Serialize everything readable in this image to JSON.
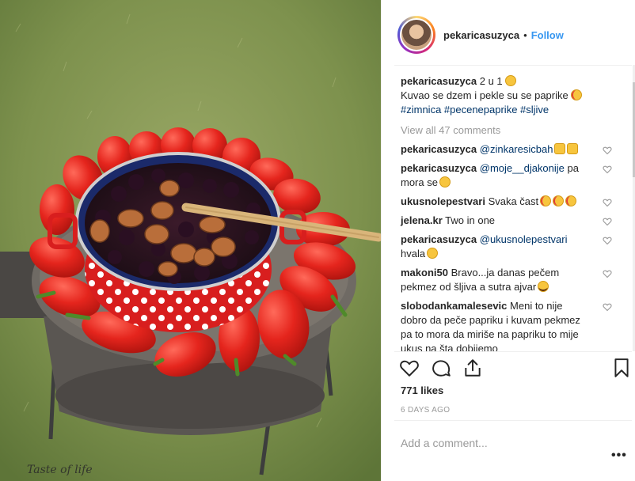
{
  "photo": {
    "watermark": "Taste of life"
  },
  "header": {
    "username": "pekaricasuzyca",
    "separator": "•",
    "follow_label": "Follow"
  },
  "caption": {
    "username": "pekaricasuzyca",
    "line1": "2 u 1",
    "line2": "Kuvao se dzem i pekle su se paprike",
    "hashtags": "#zimnica #pecenepaprike #sljive"
  },
  "view_all_label": "View all 47 comments",
  "comments": [
    {
      "user": "pekaricasuzyca",
      "mention": "@zinkaresicbah",
      "text": "",
      "emoji": [
        "thumbs-up-emoji",
        "thumbs-up-emoji"
      ]
    },
    {
      "user": "pekaricasuzyca",
      "mention": "@moje__djakonije",
      "text": " pa mora se",
      "emoji": [
        "hugging-emoji"
      ]
    },
    {
      "user": "ukusnolepestvari",
      "mention": "",
      "text": "Svaka čast",
      "emoji": [
        "star-struck-emoji",
        "star-struck-emoji",
        "star-struck-emoji"
      ]
    },
    {
      "user": "jelena.kr",
      "mention": "",
      "text": "Two in one",
      "emoji": []
    },
    {
      "user": "pekaricasuzyca",
      "mention": "@ukusnolepestvari",
      "text": " hvala",
      "emoji": [
        "hugging-emoji"
      ]
    },
    {
      "user": "makoni50",
      "mention": "",
      "text": "Bravo...ja danas pečem pekmez od šljiva a sutra ajvar",
      "emoji": [
        "laughing-emoji"
      ]
    },
    {
      "user": "slobodankamalesevic",
      "mention": "",
      "text": "Meni to nije dobro da peče papriku i kuvam pekmez pa to mora da miriše na papriku to mije ukus na šta dobijemo",
      "emoji": []
    }
  ],
  "likes_label": "771 likes",
  "time_label": "6 DAYS AGO",
  "add_comment": {
    "placeholder": "Add a comment..."
  },
  "more_label": "•••",
  "colors": {
    "accent": "#3897f0",
    "hashtag": "#003569",
    "muted": "#999999"
  }
}
